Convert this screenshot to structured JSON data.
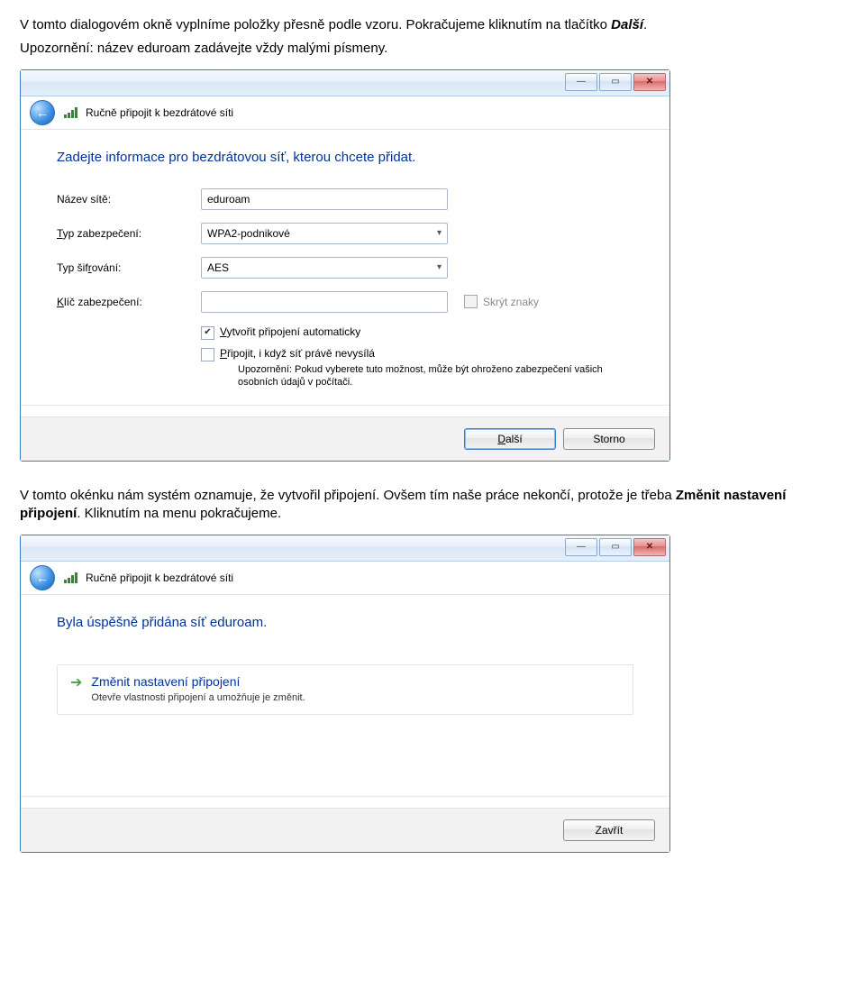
{
  "doc": {
    "para1_a": "V tomto dialogovém okně vyplníme položky přesně podle vzoru. Pokračujeme kliknutím na tlačítko ",
    "para1_b": "Další",
    "para1_c": ".",
    "para2": "Upozornění: název eduroam zadávejte vždy malými písmeny.",
    "para3_a": "V tomto okénku nám systém oznamuje, že vytvořil připojení. Ovšem tím naše práce nekončí, protože je třeba ",
    "para3_b": "Změnit nastavení připojení",
    "para3_c": ". Kliknutím na menu pokračujeme."
  },
  "win1": {
    "nav_title": "Ručně připojit k bezdrátové síti",
    "instruction": "Zadejte informace pro bezdrátovou síť, kterou chcete přidat.",
    "lbl_name": "Název sítě:",
    "val_name": "eduroam",
    "lbl_sec_pre": "T",
    "lbl_sec_rest": "yp zabezpečení:",
    "val_sec": "WPA2-podnikové",
    "lbl_enc_pre": "Typ šif",
    "lbl_enc_u": "r",
    "lbl_enc_rest": "ování:",
    "val_enc": "AES",
    "lbl_key_pre": "K",
    "lbl_key_rest": "líč zabezpečení:",
    "hide_chars": "Skrýt znaky",
    "cb1_pre": "V",
    "cb1_rest": "ytvořit připojení automaticky",
    "cb2_pre": "P",
    "cb2_rest": "řipojit, i když síť právě nevysílá",
    "warn": "Upozornění: Pokud vyberete tuto možnost, může být ohroženo zabezpečení vašich osobních údajů v počítači.",
    "btn_next_pre": "D",
    "btn_next_rest": "alší",
    "btn_cancel": "Storno"
  },
  "win2": {
    "nav_title": "Ručně připojit k bezdrátové síti",
    "success": "Byla úspěšně přidána síť eduroam.",
    "opt_title": "Změnit nastavení připojení",
    "opt_sub": "Otevře vlastnosti připojení a umožňuje je změnit.",
    "btn_close": "Zavřít"
  }
}
